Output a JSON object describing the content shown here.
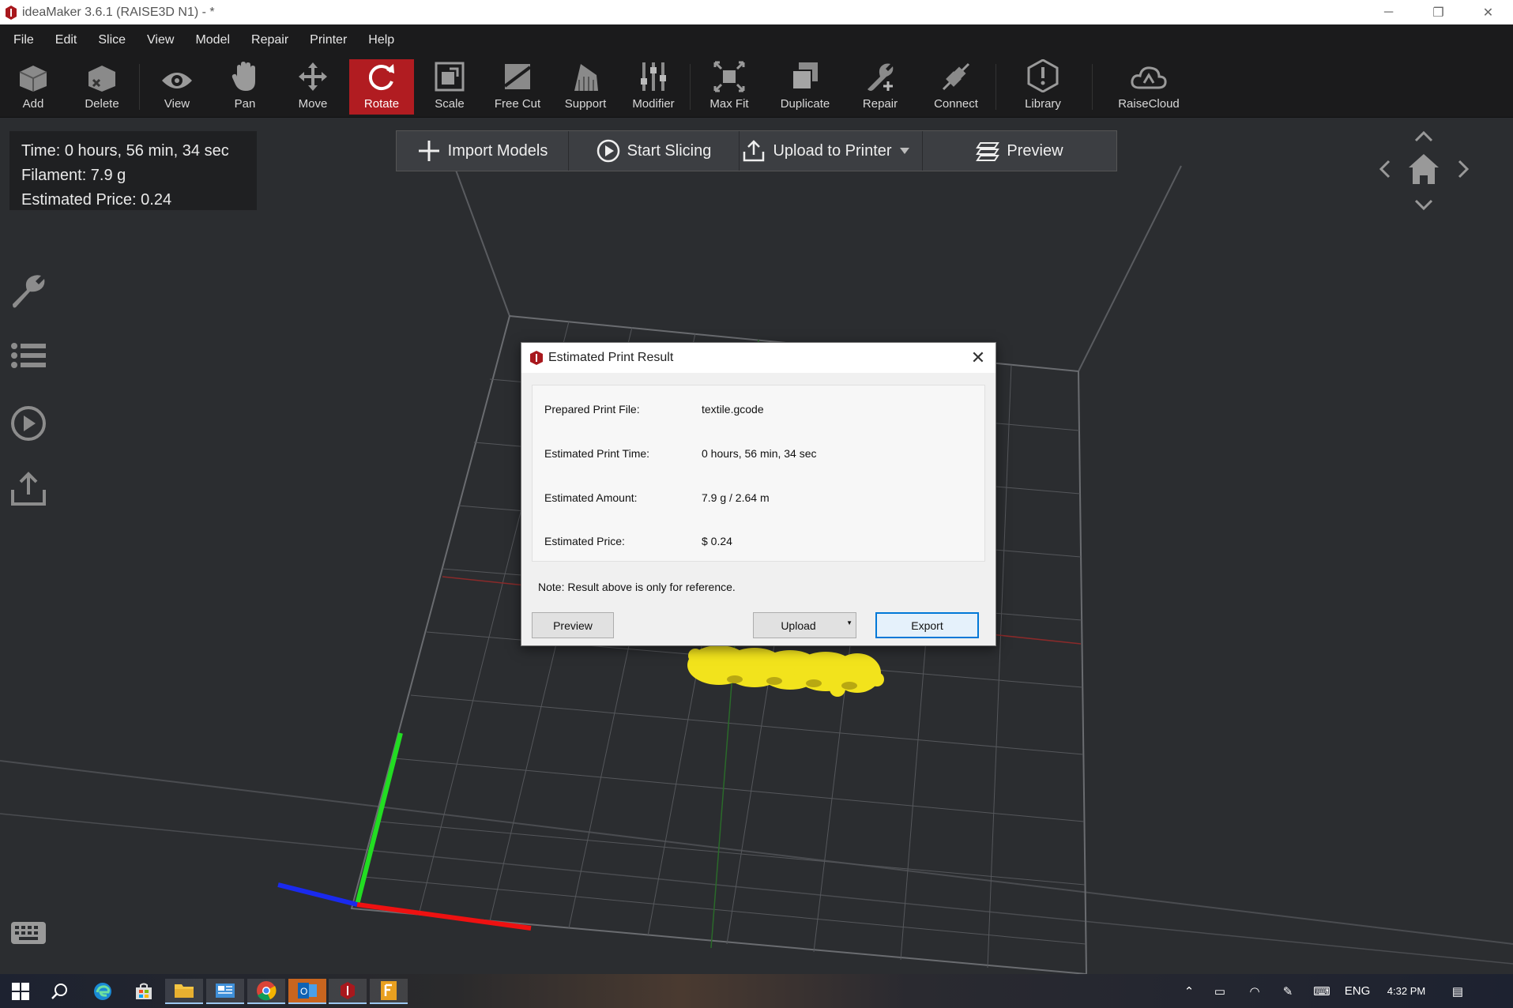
{
  "window": {
    "title": "ideaMaker 3.6.1 (RAISE3D N1) - *",
    "controls": {
      "minimize": "─",
      "restore": "❐",
      "close": "✕"
    }
  },
  "menu": [
    "File",
    "Edit",
    "Slice",
    "View",
    "Model",
    "Repair",
    "Printer",
    "Help"
  ],
  "toolbar": {
    "tools": [
      {
        "label": "Add",
        "icon": "add-cube-icon"
      },
      {
        "label": "Delete",
        "icon": "delete-cube-icon"
      },
      {
        "label": "View",
        "icon": "eye-icon"
      },
      {
        "label": "Pan",
        "icon": "hand-icon"
      },
      {
        "label": "Move",
        "icon": "move-arrows-icon"
      },
      {
        "label": "Rotate",
        "icon": "rotate-icon",
        "active": true
      },
      {
        "label": "Scale",
        "icon": "scale-icon"
      },
      {
        "label": "Free Cut",
        "icon": "cut-icon"
      },
      {
        "label": "Support",
        "icon": "support-icon"
      },
      {
        "label": "Modifier",
        "icon": "sliders-icon"
      },
      {
        "label": "Max Fit",
        "icon": "maxfit-icon"
      },
      {
        "label": "Duplicate",
        "icon": "duplicate-icon"
      },
      {
        "label": "Repair",
        "icon": "wrench-plus-icon"
      },
      {
        "label": "Connect",
        "icon": "connect-icon"
      },
      {
        "label": "Library",
        "icon": "library-icon"
      },
      {
        "label": "RaiseCloud",
        "icon": "cloud-icon"
      }
    ]
  },
  "info": {
    "time": "Time: 0 hours, 56 min, 34 sec",
    "filament": "Filament: 7.9 g",
    "price": "Estimated Price: 0.24"
  },
  "actions": {
    "import": "Import Models",
    "slice": "Start Slicing",
    "upload": "Upload to Printer",
    "preview": "Preview"
  },
  "dialog": {
    "title": "Estimated Print Result",
    "rows": [
      {
        "key": "Prepared Print File:",
        "value": "textile.gcode"
      },
      {
        "key": "Estimated Print Time:",
        "value": "0 hours, 56 min, 34 sec"
      },
      {
        "key": "Estimated Amount:",
        "value": "7.9 g / 2.64 m"
      },
      {
        "key": "Estimated Price:",
        "value": "$ 0.24"
      }
    ],
    "note": "Note: Result above is only for reference.",
    "buttons": {
      "preview": "Preview",
      "upload": "Upload",
      "export": "Export"
    }
  },
  "tray": {
    "lang": "ENG",
    "time": "4:32 PM"
  },
  "colors": {
    "accent": "#b11c21",
    "background": "#2b2d30",
    "toolbar": "#1b1b1c",
    "model": "#f2e31c"
  }
}
